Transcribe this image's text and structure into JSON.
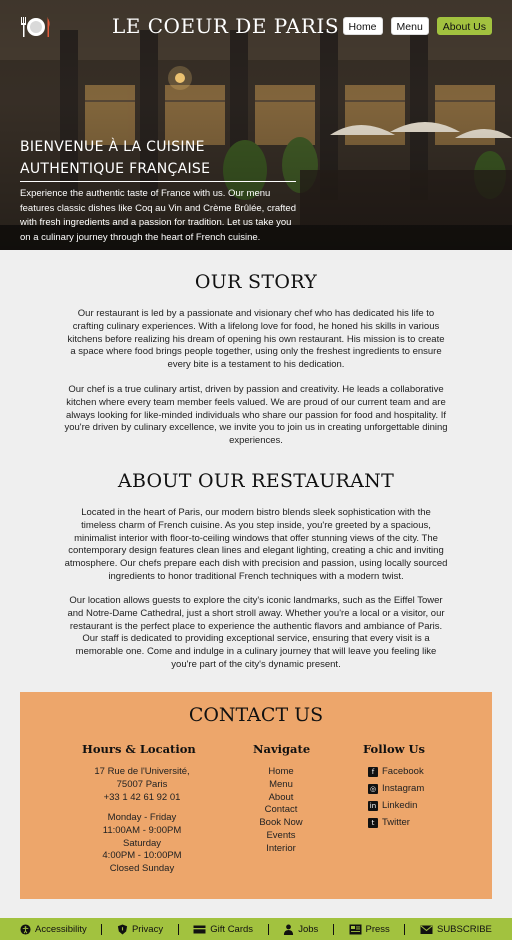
{
  "header": {
    "brand": "LE COEUR DE PARIS",
    "nav": [
      "Home",
      "Menu",
      "About Us"
    ],
    "active_nav": "About Us"
  },
  "hero": {
    "title_line1": "BIENVENUE À LA CUISINE",
    "title_line2": "AUTHENTIQUE FRANÇAISE",
    "description": "Experience the authentic taste of France with us. Our menu features classic dishes like Coq au Vin and Crème Brûlée, crafted with fresh ingredients and a passion for tradition. Let us take you on a culinary journey through the heart of French cuisine."
  },
  "story": {
    "title": "OUR STORY",
    "p1": "Our restaurant is led by a passionate and visionary chef who has dedicated his life to crafting culinary experiences. With a lifelong love for food, he honed his skills in various kitchens before realizing his dream of opening his own restaurant. His mission is to create a space where food brings people together, using only the freshest ingredients to ensure every bite is a testament to his dedication.",
    "p2": "Our chef is a true culinary artist, driven by passion and creativity. He leads a collaborative kitchen where every team member feels valued. We are proud of our current team and are always looking for like-minded individuals who share our passion for food and hospitality. If you're driven by culinary excellence, we invite you to join us in creating unforgettable dining experiences."
  },
  "about": {
    "title": "ABOUT OUR RESTAURANT",
    "p1": "Located in the heart of Paris, our modern bistro blends sleek sophistication with the timeless charm of French cuisine. As you step inside, you're greeted by a spacious, minimalist interior with floor-to-ceiling windows that offer stunning views of the city. The contemporary design features clean lines and elegant lighting, creating a chic and inviting atmosphere. Our chefs prepare each dish with precision and passion, using locally sourced ingredients to honor traditional French techniques with a modern twist.",
    "p2": "Our location allows guests to explore the city's iconic landmarks, such as the Eiffel Tower and Notre-Dame Cathedral, just a short stroll away. Whether you're a local or a visitor, our restaurant is the perfect place to experience the authentic flavors and ambiance of Paris. Our staff is dedicated to providing exceptional service, ensuring that every visit is a memorable one. Come and indulge in a culinary journey that will leave you feeling like you're part of the city's dynamic present."
  },
  "contact": {
    "title": "CONTACT US",
    "hours_title": "Hours & Location",
    "address": [
      "17 Rue de l'Université,",
      "75007 Paris",
      "+33 1 42 61 92 01"
    ],
    "hours": [
      "Monday - Friday",
      "11:00AM - 9:00PM",
      "Saturday",
      "4:00PM - 10:00PM",
      "Closed Sunday"
    ],
    "navigate_title": "Navigate",
    "navigate": [
      "Home",
      "Menu",
      "About",
      "Contact",
      "Book Now",
      "Events",
      "Interior"
    ],
    "follow_title": "Follow Us",
    "follow": [
      {
        "label": "Facebook",
        "icon": "facebook-icon"
      },
      {
        "label": "Instagram",
        "icon": "instagram-icon"
      },
      {
        "label": "Linkedin",
        "icon": "linkedin-icon"
      },
      {
        "label": "Twitter",
        "icon": "twitter-icon"
      }
    ]
  },
  "footer": {
    "items": [
      {
        "label": "Accessibility",
        "icon": "accessibility-icon"
      },
      {
        "label": "Privacy",
        "icon": "shield-icon"
      },
      {
        "label": "Gift Cards",
        "icon": "gift-card-icon"
      },
      {
        "label": "Jobs",
        "icon": "person-icon"
      },
      {
        "label": "Press",
        "icon": "newspaper-icon"
      },
      {
        "label": "SUBSCRIBE",
        "icon": "mail-icon"
      }
    ]
  },
  "colors": {
    "accent": "#a2c23f",
    "contact_bg": "#eda66b",
    "page_bg": "#efefef"
  }
}
